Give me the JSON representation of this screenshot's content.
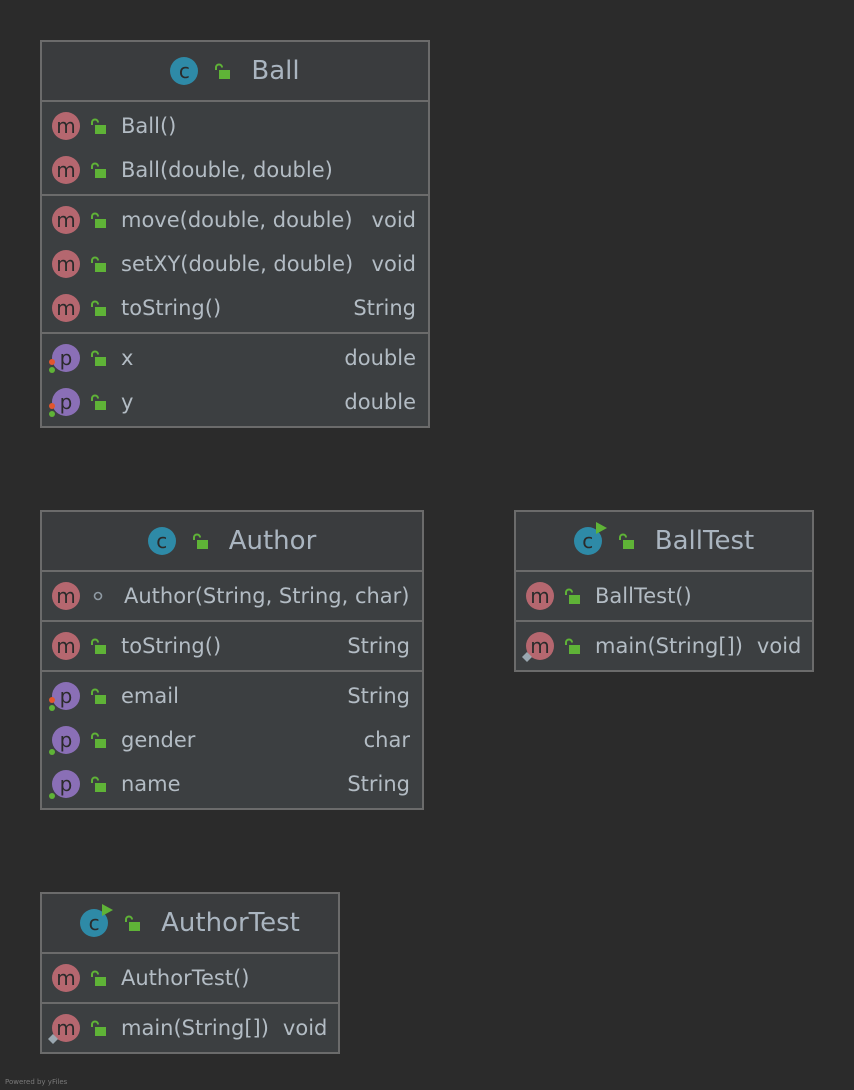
{
  "classes": {
    "ball": {
      "name": "Ball",
      "constructors": [
        {
          "name": "Ball()"
        },
        {
          "name": "Ball(double, double)"
        }
      ],
      "methods": [
        {
          "name": "move(double, double)",
          "type": "void"
        },
        {
          "name": "setXY(double, double)",
          "type": "void"
        },
        {
          "name": "toString()",
          "type": "String"
        }
      ],
      "properties": [
        {
          "name": "x",
          "type": "double"
        },
        {
          "name": "y",
          "type": "double"
        }
      ]
    },
    "author": {
      "name": "Author",
      "constructors": [
        {
          "name": "Author(String, String, char)"
        }
      ],
      "methods": [
        {
          "name": "toString()",
          "type": "String"
        }
      ],
      "properties": [
        {
          "name": "email",
          "type": "String"
        },
        {
          "name": "gender",
          "type": "char"
        },
        {
          "name": "name",
          "type": "String"
        }
      ]
    },
    "balltest": {
      "name": "BallTest",
      "constructors": [
        {
          "name": "BallTest()"
        }
      ],
      "methods": [
        {
          "name": "main(String[])",
          "type": "void"
        }
      ]
    },
    "authortest": {
      "name": "AuthorTest",
      "constructors": [
        {
          "name": "AuthorTest()"
        }
      ],
      "methods": [
        {
          "name": "main(String[])",
          "type": "void"
        }
      ]
    }
  },
  "icons": {
    "class": "c",
    "method": "m",
    "property": "p"
  },
  "colors": {
    "background": "#2b2b2b",
    "box": "#3c3f41",
    "border": "#6b6b6b",
    "method_badge": "#b5676f",
    "property_badge": "#8a6fb6",
    "class_badge": "#2e8aa7",
    "lock": "#5fb337"
  },
  "footer": "Powered by yFiles"
}
